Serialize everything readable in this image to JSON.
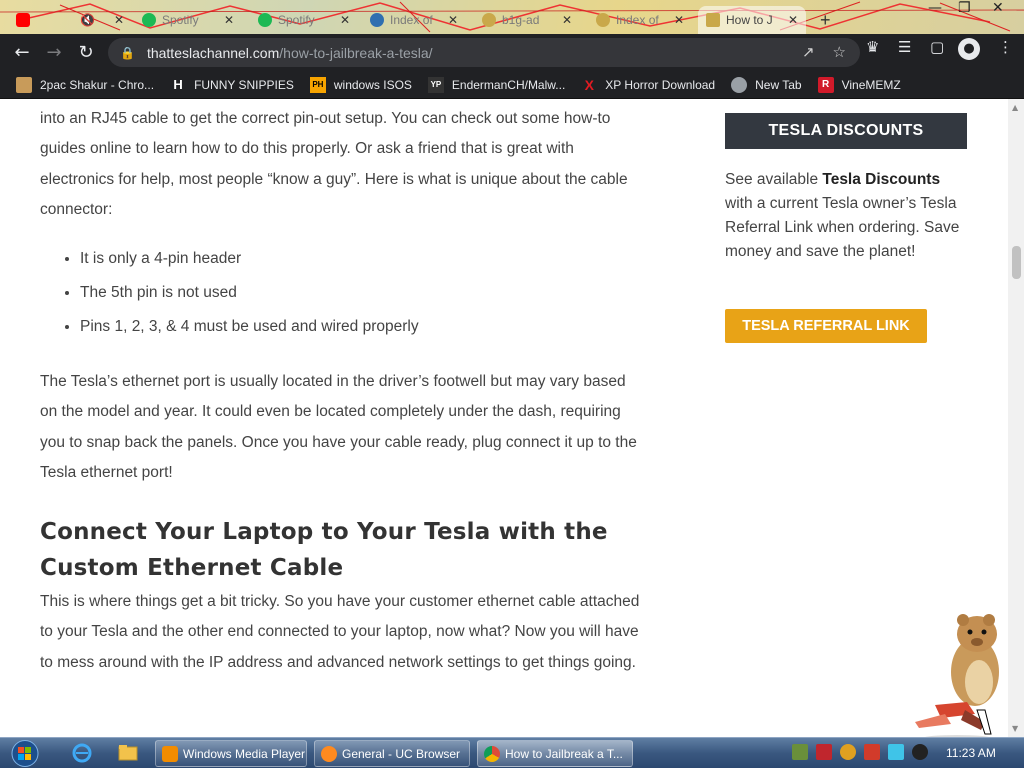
{
  "tabs": [
    {
      "title": "",
      "icon": "youtube-icon",
      "color": "#ff0000"
    },
    {
      "title": "",
      "icon": "mute-icon",
      "color": "#555555"
    },
    {
      "title": "Spotify",
      "icon": "spotify-icon",
      "color": "#1db954"
    },
    {
      "title": "Spotify",
      "icon": "spotify-icon",
      "color": "#1db954"
    },
    {
      "title": "Index of",
      "icon": "globe-icon",
      "color": "#2f6fb0"
    },
    {
      "title": "b1g-ad",
      "icon": "page-icon",
      "color": "#c9a84a"
    },
    {
      "title": "Index of",
      "icon": "page-icon",
      "color": "#c9a84a"
    },
    {
      "title": "How to J",
      "icon": "tesla-icon",
      "color": "#c9a84a"
    }
  ],
  "address": {
    "host": "thatteslachannel.com",
    "path": "/how-to-jailbreak-a-tesla/"
  },
  "bookmarks": [
    {
      "label": "2pac Shakur - Chro...",
      "icon": "photo-icon",
      "color": "#c89b5a"
    },
    {
      "label": "FUNNY SNIPPIES",
      "icon": "h-icon",
      "glyph": "H",
      "color": "#ffffff"
    },
    {
      "label": "windows ISOS",
      "icon": "ph-icon",
      "glyph": "PH",
      "color": "#f7a400"
    },
    {
      "label": "EndermanCH/Malw...",
      "icon": "yp-icon",
      "glyph": "YP",
      "color": "#333333"
    },
    {
      "label": "XP Horror Download",
      "icon": "x-icon",
      "glyph": "X",
      "color": "#e11b22"
    },
    {
      "label": "New Tab",
      "icon": "chrome-icon",
      "color": "#9aa0a6"
    },
    {
      "label": "VineMEMZ",
      "icon": "r-icon",
      "glyph": "R",
      "color": "#d11a2a"
    }
  ],
  "article": {
    "p1": "into an RJ45 cable to get the correct pin-out setup. You can check out some how-to guides online to learn how to do this properly. Or ask a friend that is great with electronics for help, most people “know a guy”.  Here is what is unique about the cable connector:",
    "bullets": [
      "It is only a 4-pin header",
      "The 5th pin is not used",
      "Pins 1, 2, 3, & 4 must be used and wired properly"
    ],
    "p2": "The Tesla’s ethernet port is usually located in the driver’s footwell but may vary based on the model and year. It could even be located completely under the dash, requiring you to snap back the panels. Once you have your cable ready, plug connect it up to the Tesla ethernet port!",
    "heading": "Connect Your Laptop to Your Tesla with the Custom Ethernet Cable",
    "p3": "This is where things get a bit tricky. So you have your customer ethernet cable attached to your Tesla and the other end connected to your laptop, now what? Now you will have to mess around with the IP address and advanced network settings to get things going."
  },
  "sidebar": {
    "heading": "TESLA DISCOUNTS",
    "text_pre": "See available ",
    "text_bold": "Tesla Discounts",
    "text_post": " with a current Tesla owner’s Tesla Referral Link when ordering. Save money and save the planet!",
    "button": "TESLA REFERRAL LINK",
    "button_color": "#e8a317"
  },
  "taskbar": {
    "tasks": [
      {
        "label": "Windows Media Player",
        "icon": "media-player-icon",
        "color": "#f28c00"
      },
      {
        "label": "General - UC Browser",
        "icon": "uc-browser-icon",
        "color": "#ff8a1f"
      },
      {
        "label": "How to Jailbreak a T...",
        "icon": "chrome-icon",
        "color": "#dd4b39"
      }
    ],
    "clock": "11:23 AM"
  }
}
